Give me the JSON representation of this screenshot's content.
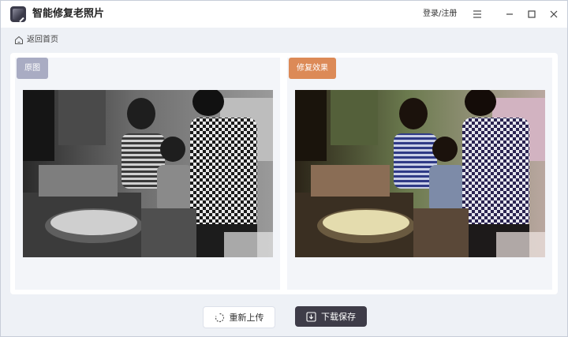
{
  "app": {
    "title": "智能修复老照片",
    "login_label": "登录/注册"
  },
  "titlebar": {
    "icons": [
      "menu-icon",
      "minimize-icon",
      "maximize-icon",
      "close-icon"
    ]
  },
  "breadcrumb": {
    "label": "返回首页",
    "icon": "home-icon"
  },
  "panels": {
    "original": {
      "tag": "原图"
    },
    "restored": {
      "tag": "修复效果"
    }
  },
  "actions": {
    "reupload_label": "重新上传",
    "download_label": "下载保存"
  },
  "colors": {
    "original_tag": "#a9acc3",
    "restored_tag": "#dc8a57",
    "download_button": "#3e3c48",
    "window_background": "#eef1f6"
  }
}
